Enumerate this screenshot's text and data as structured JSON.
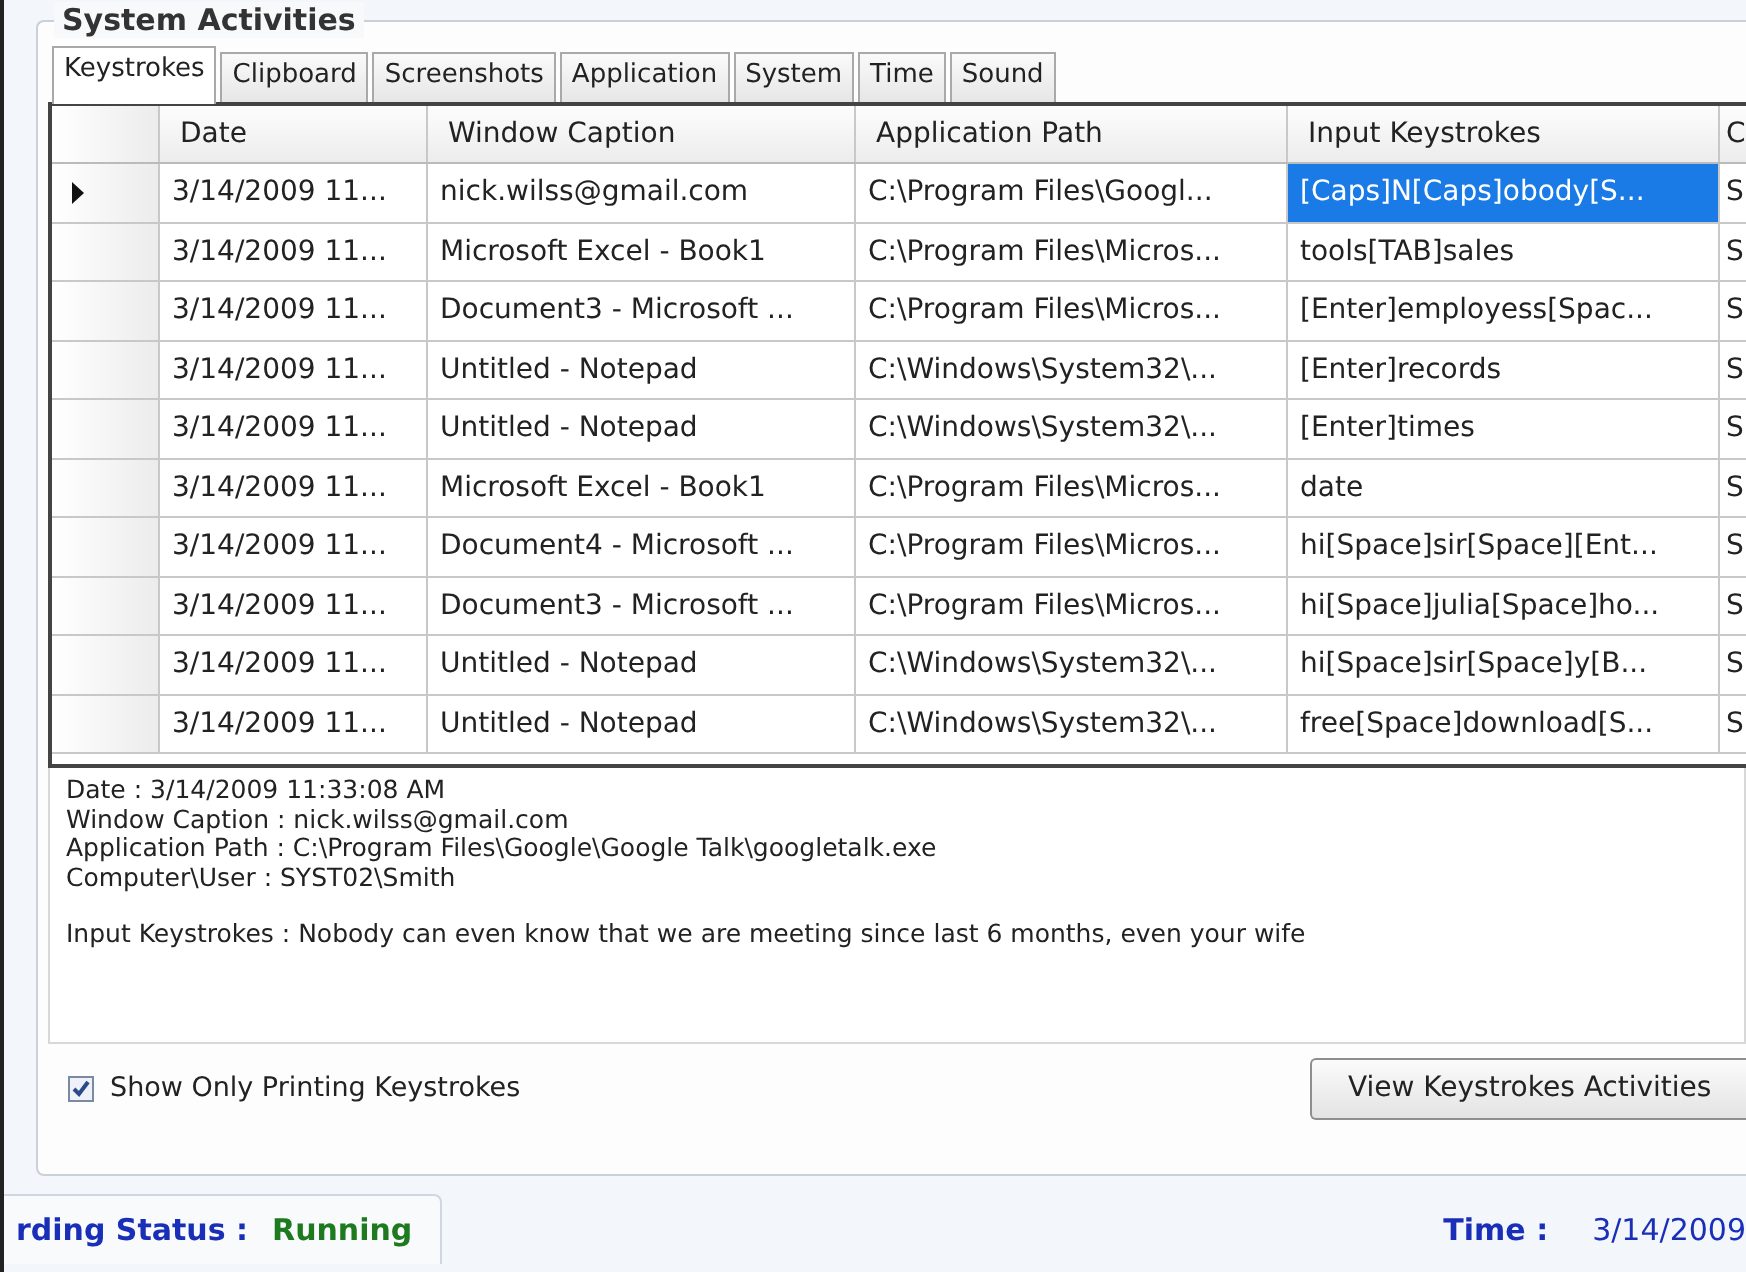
{
  "group": {
    "title": "System Activities"
  },
  "tabs": [
    {
      "label": "Keystrokes",
      "selected": true
    },
    {
      "label": "Clipboard",
      "selected": false
    },
    {
      "label": "Screenshots",
      "selected": false
    },
    {
      "label": "Application",
      "selected": false
    },
    {
      "label": "System",
      "selected": false
    },
    {
      "label": "Time",
      "selected": false
    },
    {
      "label": "Sound",
      "selected": false
    }
  ],
  "table": {
    "columns": [
      "Date",
      "Window Caption",
      "Application Path",
      "Input Keystrokes",
      "C"
    ],
    "rows": [
      {
        "selected": true,
        "cells": [
          {
            "text": "3/14/2009 11...",
            "selected": false
          },
          {
            "text": "nick.wilss@gmail.com",
            "selected": false
          },
          {
            "text": "C:\\Program Files\\Googl...",
            "selected": false
          },
          {
            "text": "[Caps]N[Caps]obody[S...",
            "selected": true
          },
          {
            "text": "S",
            "selected": false
          }
        ]
      },
      {
        "selected": false,
        "cells": [
          {
            "text": "3/14/2009 11...",
            "selected": false
          },
          {
            "text": "Microsoft Excel - Book1",
            "selected": false
          },
          {
            "text": "C:\\Program Files\\Micros...",
            "selected": false
          },
          {
            "text": "tools[TAB]sales",
            "selected": false
          },
          {
            "text": "S",
            "selected": false
          }
        ]
      },
      {
        "selected": false,
        "cells": [
          {
            "text": "3/14/2009 11...",
            "selected": false
          },
          {
            "text": "Document3 - Microsoft ...",
            "selected": false
          },
          {
            "text": "C:\\Program Files\\Micros...",
            "selected": false
          },
          {
            "text": "[Enter]employess[Spac...",
            "selected": false
          },
          {
            "text": "S",
            "selected": false
          }
        ]
      },
      {
        "selected": false,
        "cells": [
          {
            "text": "3/14/2009 11...",
            "selected": false
          },
          {
            "text": "Untitled - Notepad",
            "selected": false
          },
          {
            "text": "C:\\Windows\\System32\\...",
            "selected": false
          },
          {
            "text": "[Enter]records",
            "selected": false
          },
          {
            "text": "S",
            "selected": false
          }
        ]
      },
      {
        "selected": false,
        "cells": [
          {
            "text": "3/14/2009 11...",
            "selected": false
          },
          {
            "text": "Untitled - Notepad",
            "selected": false
          },
          {
            "text": "C:\\Windows\\System32\\...",
            "selected": false
          },
          {
            "text": "[Enter]times",
            "selected": false
          },
          {
            "text": "S",
            "selected": false
          }
        ]
      },
      {
        "selected": false,
        "cells": [
          {
            "text": "3/14/2009 11...",
            "selected": false
          },
          {
            "text": "Microsoft Excel - Book1",
            "selected": false
          },
          {
            "text": "C:\\Program Files\\Micros...",
            "selected": false
          },
          {
            "text": "date",
            "selected": false
          },
          {
            "text": "S",
            "selected": false
          }
        ]
      },
      {
        "selected": false,
        "cells": [
          {
            "text": "3/14/2009 11...",
            "selected": false
          },
          {
            "text": "Document4 - Microsoft ...",
            "selected": false
          },
          {
            "text": "C:\\Program Files\\Micros...",
            "selected": false
          },
          {
            "text": "hi[Space]sir[Space][Ent...",
            "selected": false
          },
          {
            "text": "S",
            "selected": false
          }
        ]
      },
      {
        "selected": false,
        "cells": [
          {
            "text": "3/14/2009 11...",
            "selected": false
          },
          {
            "text": "Document3 - Microsoft ...",
            "selected": false
          },
          {
            "text": "C:\\Program Files\\Micros...",
            "selected": false
          },
          {
            "text": "hi[Space]julia[Space]ho...",
            "selected": false
          },
          {
            "text": "S",
            "selected": false
          }
        ]
      },
      {
        "selected": false,
        "cells": [
          {
            "text": "3/14/2009 11...",
            "selected": false
          },
          {
            "text": "Untitled - Notepad",
            "selected": false
          },
          {
            "text": "C:\\Windows\\System32\\...",
            "selected": false
          },
          {
            "text": "hi[Space]sir[Space]y[B...",
            "selected": false
          },
          {
            "text": "S",
            "selected": false
          }
        ]
      },
      {
        "selected": false,
        "cells": [
          {
            "text": "3/14/2009 11...",
            "selected": false
          },
          {
            "text": "Untitled - Notepad",
            "selected": false
          },
          {
            "text": "C:\\Windows\\System32\\...",
            "selected": false
          },
          {
            "text": "free[Space]download[S...",
            "selected": false
          },
          {
            "text": "S",
            "selected": false
          }
        ]
      }
    ]
  },
  "details": {
    "lines": [
      "Date : 3/14/2009 11:33:08 AM",
      "Window Caption : nick.wilss@gmail.com",
      "Application Path : C:\\Program Files\\Google\\Google Talk\\googletalk.exe",
      "Computer\\User : SYST02\\Smith"
    ],
    "keystrokes": "Input Keystrokes : Nobody can even know that we are meeting since last 6 months, even your wife"
  },
  "options": {
    "label": "Show Only Printing Keystrokes",
    "checked": true
  },
  "view_button": {
    "label": "View Keystrokes Activities"
  },
  "status_bar": {
    "status_label": "rding Status :",
    "status_value": "Running",
    "time_label": "Time :",
    "time_value": "3/14/2009"
  }
}
